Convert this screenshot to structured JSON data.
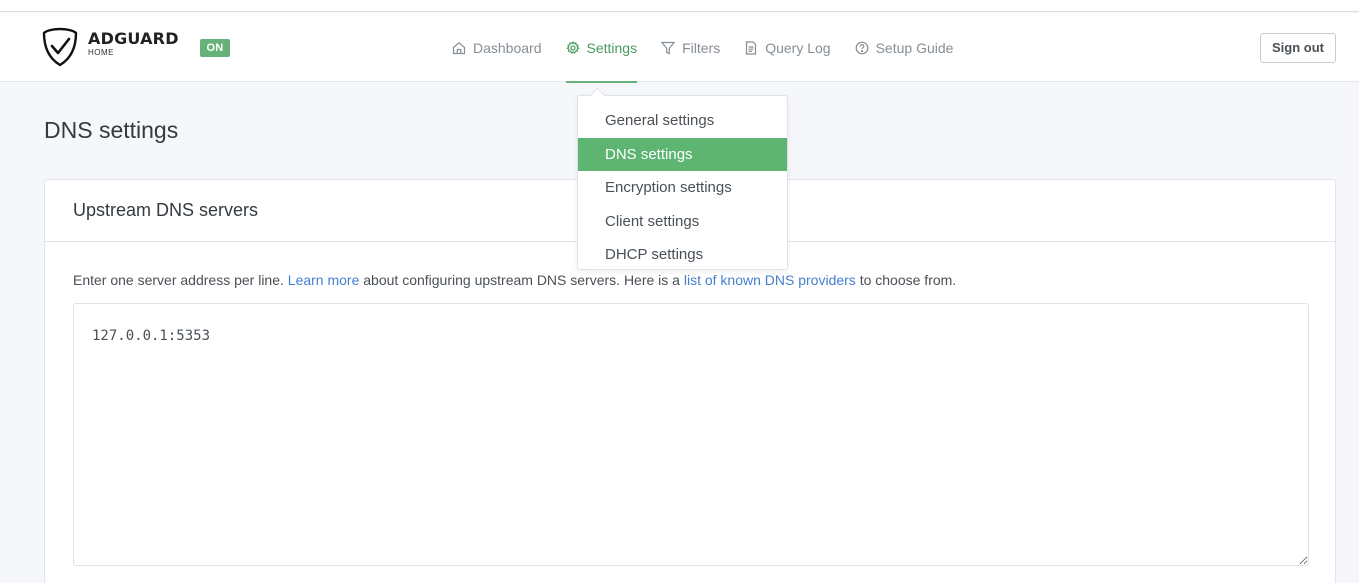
{
  "brand": {
    "title": "ADGUARD",
    "subtitle": "HOME",
    "status_badge": "ON"
  },
  "nav": {
    "items": [
      {
        "label": "Dashboard",
        "icon": "home-icon",
        "active": false
      },
      {
        "label": "Settings",
        "icon": "gear-icon",
        "active": true
      },
      {
        "label": "Filters",
        "icon": "filter-icon",
        "active": false
      },
      {
        "label": "Query Log",
        "icon": "document-icon",
        "active": false
      },
      {
        "label": "Setup Guide",
        "icon": "help-circle-icon",
        "active": false
      }
    ],
    "sign_out_label": "Sign out"
  },
  "settings_menu": {
    "items": [
      {
        "label": "General settings",
        "selected": false
      },
      {
        "label": "DNS settings",
        "selected": true
      },
      {
        "label": "Encryption settings",
        "selected": false
      },
      {
        "label": "Client settings",
        "selected": false
      },
      {
        "label": "DHCP settings",
        "selected": false
      }
    ]
  },
  "page": {
    "title": "DNS settings"
  },
  "upstream_card": {
    "title": "Upstream DNS servers",
    "desc_prefix": "Enter one server address per line. ",
    "learn_more_link": "Learn more",
    "desc_middle": " about configuring upstream DNS servers. Here is a ",
    "providers_link": "list of known DNS providers",
    "desc_suffix": " to choose from.",
    "textarea_value": "127.0.0.1:5353"
  },
  "colors": {
    "accent_green": "#67b279",
    "link_blue": "#467fcf",
    "page_background": "#f5f7fb"
  }
}
